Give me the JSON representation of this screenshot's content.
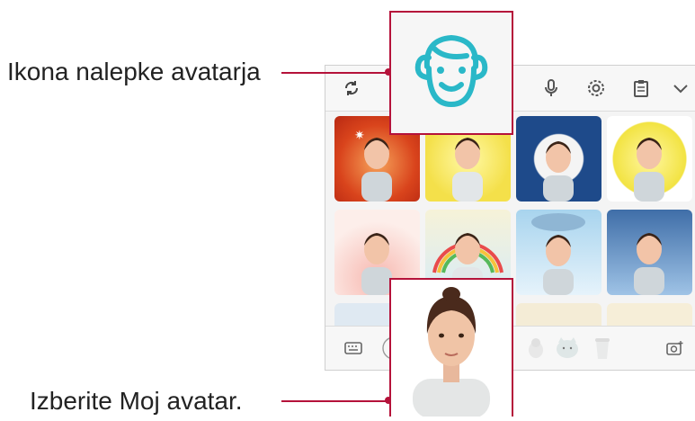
{
  "callouts": {
    "sticker_icon_label": "Ikona nalepke avatarja",
    "my_avatar_label": "Izberite Moj avatar."
  },
  "toolbar": {
    "icons": [
      "refresh-icon",
      "microphone-icon",
      "settings-icon",
      "clipboard-icon",
      "chevron-down-icon"
    ]
  },
  "bottom_bar": {
    "icons": [
      "keyboard-icon",
      "avatar-ring-icon",
      "chick-sticker-icon",
      "cat-sticker-icon",
      "cup-sticker-icon",
      "add-camera-icon"
    ]
  },
  "colors": {
    "accent": "#b5123a",
    "icon_cyan": "#2ab8c8"
  }
}
